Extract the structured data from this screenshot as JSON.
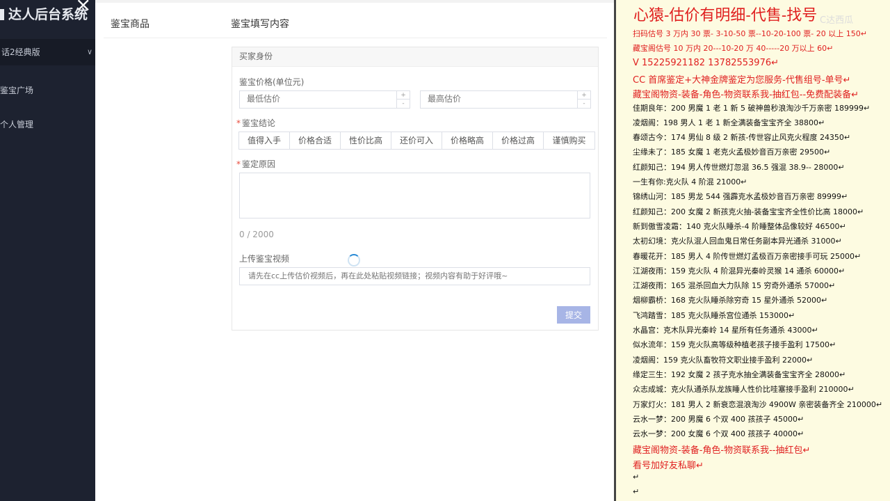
{
  "sidebar": {
    "logo": "达人后台系统",
    "version": "话2经典版",
    "items": [
      {
        "label": "鉴宝广场"
      },
      {
        "label": "个人管理"
      }
    ]
  },
  "panel": {
    "tab_goods": "鉴宝商品",
    "tab_content": "鉴宝填写内容",
    "card_header": "买家身份",
    "price_label": "鉴宝价格(单位元)",
    "min_placeholder": "最低估价",
    "max_placeholder": "最高估价",
    "conclusion_label": "鉴宝结论",
    "conclusion_options": [
      "值得入手",
      "价格合适",
      "性价比高",
      "还价可入",
      "价格略高",
      "价格过高",
      "谨慎购买"
    ],
    "reason_label": "鉴定原因",
    "counter": "0 / 2000",
    "video_label": "上传鉴宝视频",
    "video_placeholder": "请先在cc上传估价视频后，再在此处粘贴视频链接；视频内容有助于好评哦~",
    "submit_label": "提交"
  },
  "info": {
    "title": "心猿-估价有明细-代售-找号",
    "watermark": "C达西瓜",
    "lines": [
      {
        "text": "扫码估号 3 万内 30 票- 3-10-50 票--10-20-100 票- 20 以上 150↵",
        "color": "red"
      },
      {
        "text": "藏宝阁估号 10 万内 20---10-20 万 40-----20 万以上 60↵",
        "color": "red"
      },
      {
        "text": " V 15225921182   13782553976↵",
        "color": "red",
        "big": true
      },
      {
        "text": "CC 首席鉴定+大神金牌鉴定为您服务-代售组号-单号↵",
        "color": "red",
        "big": true
      },
      {
        "text": "藏宝阁物资-装备-角色-物资联系我-抽红包--免费配装备↵",
        "color": "red",
        "big": true
      },
      {
        "text": "佳期良年：200 男魔 1 老 1 新 5 破神兽秒浪淘沙千万亲密 189999↵"
      },
      {
        "text": "凌烟阁：198 男人 1 老 1 新全满装备宝宝齐全 38800↵"
      },
      {
        "text": "春颂古今：174 男仙 8 级 2 新孩-传世容止风克火程度 24350↵"
      },
      {
        "text": "尘缘未了：185 女魔 1 老克火孟极妙音百万亲密 29500↵"
      },
      {
        "text": "红颜知己：194 男人传世燃灯忽混 36.5 强混 38.9-- 28000↵"
      },
      {
        "text": "一生有你:克火队 4 阶混 21000↵"
      },
      {
        "text": "锦绣山河：185 男龙 544 强霹克水孟极妙音百万亲密 89999↵"
      },
      {
        "text": "红颜知己：200 女魔 2 新孩克火抽-装备宝宝齐全性价比高 18000↵"
      },
      {
        "text": "新到傲雪凌霜：140 克火队睡杀-4 阶睡整体品像较好 46500↵"
      },
      {
        "text": "太初幻境：克火队混人回血鬼日常任务副本异光通杀 31000↵"
      },
      {
        "text": "春暖花开：185 男人 4 阶传世燃灯孟极百万亲密接手可玩 25000↵"
      },
      {
        "text": "江湖夜雨：159 克火队 4 阶混异光秦岭灵猴 14 通杀 60000↵"
      },
      {
        "text": "江湖夜雨：165 混杀回血大力队除 15 穷奇外通杀 57000↵"
      },
      {
        "text": "烟柳霸桥：168 克火队睡杀除穷奇 15 星外通杀 52000↵"
      },
      {
        "text": "飞鸿踏雪：185 克火队睡杀宫位通杀 153000↵"
      },
      {
        "text": "水晶宫：克木队异光秦岭 14 星所有任务通杀 43000↵"
      },
      {
        "text": "似水流年：159 克火队高等级种植老孩子接手盈利 17500↵"
      },
      {
        "text": "凌烟阁：159 克火队畜牧符文职业接手盈利 22000↵"
      },
      {
        "text": "缘定三生：192 女魔 2 孩子克水抽全满装备宝宝齐全 28000↵"
      },
      {
        "text": "众志成城：克火队通杀队龙族睡人性价比哇塞接手盈利 210000↵"
      },
      {
        "text": "万家灯火：181 男人 2 新衰恋混浪淘沙 4900W 亲密装备齐全 210000↵"
      },
      {
        "text": "云水一梦：200 男魔 6 个双 400 孩孩子 45000↵"
      },
      {
        "text": "云水一梦：200 女魔 6 个双 400 孩孩子 40000↵"
      },
      {
        "text": "藏宝阁物资-装备-角色-物资联系我--抽红包↵",
        "color": "red",
        "big": true
      },
      {
        "text": "看号加好友私聊↵",
        "color": "red",
        "big": true
      },
      {
        "text": "↵"
      },
      {
        "text": "↵"
      }
    ]
  }
}
